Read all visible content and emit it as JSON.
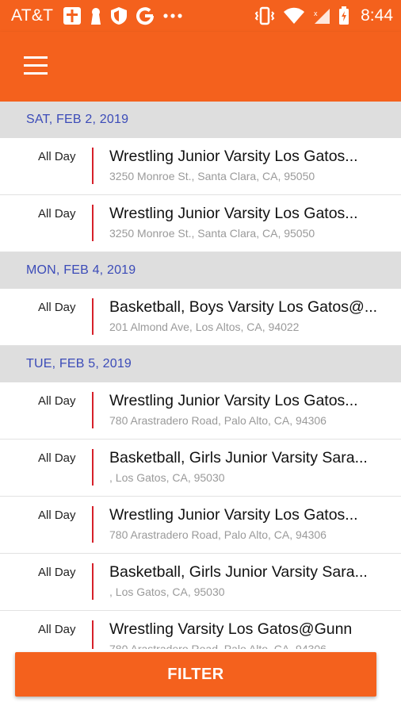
{
  "status_bar": {
    "carrier": "AT&T",
    "time": "8:44",
    "icons": [
      "phone-app-icon",
      "keyhole-icon",
      "shield-icon",
      "google-icon",
      "more-icon",
      "vibrate-icon",
      "wifi-icon",
      "signal-icon",
      "battery-icon"
    ]
  },
  "app_bar": {
    "menu_icon": "hamburger-menu-icon",
    "background": "#f4611d"
  },
  "list": [
    {
      "date": "SAT, FEB 2, 2019",
      "events": [
        {
          "time": "All Day",
          "title": "Wrestling Junior Varsity Los Gatos...",
          "address": "3250 Monroe St., Santa Clara, CA, 95050"
        },
        {
          "time": "All Day",
          "title": "Wrestling Junior Varsity Los Gatos...",
          "address": "3250 Monroe St., Santa Clara, CA, 95050"
        }
      ]
    },
    {
      "date": "MON, FEB 4, 2019",
      "events": [
        {
          "time": "All Day",
          "title": "Basketball, Boys Varsity Los Gatos@...",
          "address": "201 Almond Ave, Los Altos, CA, 94022"
        }
      ]
    },
    {
      "date": "TUE, FEB 5, 2019",
      "events": [
        {
          "time": "All Day",
          "title": "Wrestling Junior Varsity Los Gatos...",
          "address": "780 Arastradero Road, Palo Alto, CA, 94306"
        },
        {
          "time": "All Day",
          "title": "Basketball, Girls  Junior Varsity Sara...",
          "address": ", Los Gatos, CA, 95030"
        },
        {
          "time": "All Day",
          "title": "Wrestling Junior Varsity Los Gatos...",
          "address": "780 Arastradero Road, Palo Alto, CA, 94306"
        },
        {
          "time": "All Day",
          "title": "Basketball, Girls  Junior Varsity Sara...",
          "address": ", Los Gatos, CA, 95030"
        },
        {
          "time": "All Day",
          "title": "Wrestling Varsity Los Gatos@Gunn",
          "address": "780 Arastradero Road, Palo Alto, CA, 94306"
        }
      ]
    }
  ],
  "filter_button": {
    "label": "FILTER"
  },
  "colors": {
    "accent": "#f4611d",
    "date_header_text": "#3b4bb8",
    "event_bar": "#d6202a"
  }
}
